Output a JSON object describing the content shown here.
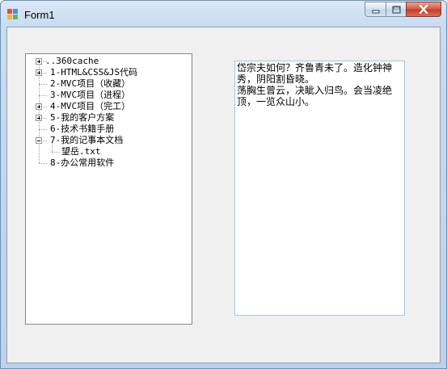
{
  "window": {
    "title": "Form1",
    "icon": "winforms-app-icon"
  },
  "title_buttons": [
    "minimize-icon",
    "maximize-icon",
    "close-icon"
  ],
  "tree": {
    "nodes": [
      {
        "label": "..360cache",
        "expander": "plus"
      },
      {
        "label": "1-HTML&CSS&JS代码",
        "expander": "plus"
      },
      {
        "label": "2-MVC项目（收藏）",
        "expander": "none"
      },
      {
        "label": "3-MVC项目（进程）",
        "expander": "none"
      },
      {
        "label": "4-MVC项目（完工）",
        "expander": "plus"
      },
      {
        "label": "5-我的客户方案",
        "expander": "plus"
      },
      {
        "label": "6-技术书籍手册",
        "expander": "none"
      },
      {
        "label": "7-我的记事本文档",
        "expander": "minus"
      },
      {
        "label": "望岳.txt",
        "expander": "none",
        "child": true
      },
      {
        "label": "8-办公常用软件",
        "expander": "none"
      }
    ]
  },
  "textbox": {
    "content": "岱宗夫如何？齐鲁青未了。造化钟神秀，阴阳割昏晓。\n荡胸生曾云，决眦入归鸟。会当凌绝顶，一览众山小。"
  }
}
